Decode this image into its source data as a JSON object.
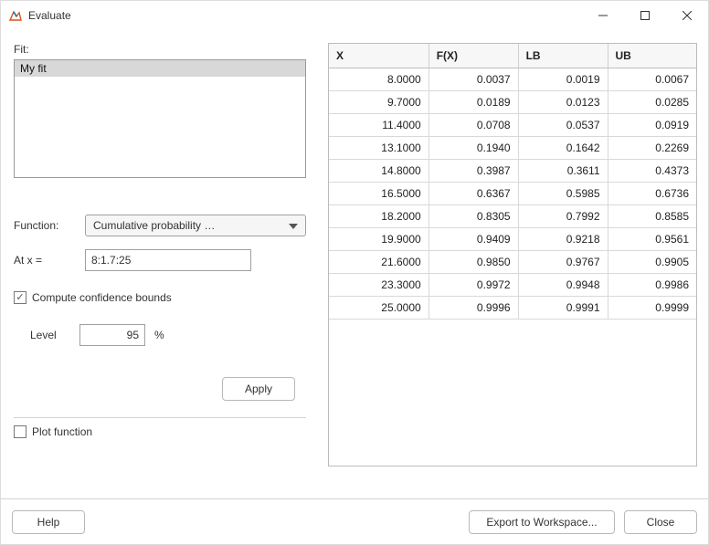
{
  "window": {
    "title": "Evaluate"
  },
  "left": {
    "fit_label": "Fit:",
    "fit_items": [
      "My fit"
    ],
    "function_label": "Function:",
    "function_value": "Cumulative probability …",
    "atx_label": "At x =",
    "atx_value": "8:1.7:25",
    "compute_bounds_label": "Compute confidence bounds",
    "compute_bounds_checked": true,
    "level_label": "Level",
    "level_value": "95",
    "level_suffix": "%",
    "apply_label": "Apply",
    "plot_label": "Plot function",
    "plot_checked": false
  },
  "table": {
    "columns": [
      "X",
      "F(X)",
      "LB",
      "UB"
    ],
    "rows": [
      [
        "8.0000",
        "0.0037",
        "0.0019",
        "0.0067"
      ],
      [
        "9.7000",
        "0.0189",
        "0.0123",
        "0.0285"
      ],
      [
        "11.4000",
        "0.0708",
        "0.0537",
        "0.0919"
      ],
      [
        "13.1000",
        "0.1940",
        "0.1642",
        "0.2269"
      ],
      [
        "14.8000",
        "0.3987",
        "0.3611",
        "0.4373"
      ],
      [
        "16.5000",
        "0.6367",
        "0.5985",
        "0.6736"
      ],
      [
        "18.2000",
        "0.8305",
        "0.7992",
        "0.8585"
      ],
      [
        "19.9000",
        "0.9409",
        "0.9218",
        "0.9561"
      ],
      [
        "21.6000",
        "0.9850",
        "0.9767",
        "0.9905"
      ],
      [
        "23.3000",
        "0.9972",
        "0.9948",
        "0.9986"
      ],
      [
        "25.0000",
        "0.9996",
        "0.9991",
        "0.9999"
      ]
    ]
  },
  "footer": {
    "help_label": "Help",
    "export_label": "Export to Workspace...",
    "close_label": "Close"
  }
}
